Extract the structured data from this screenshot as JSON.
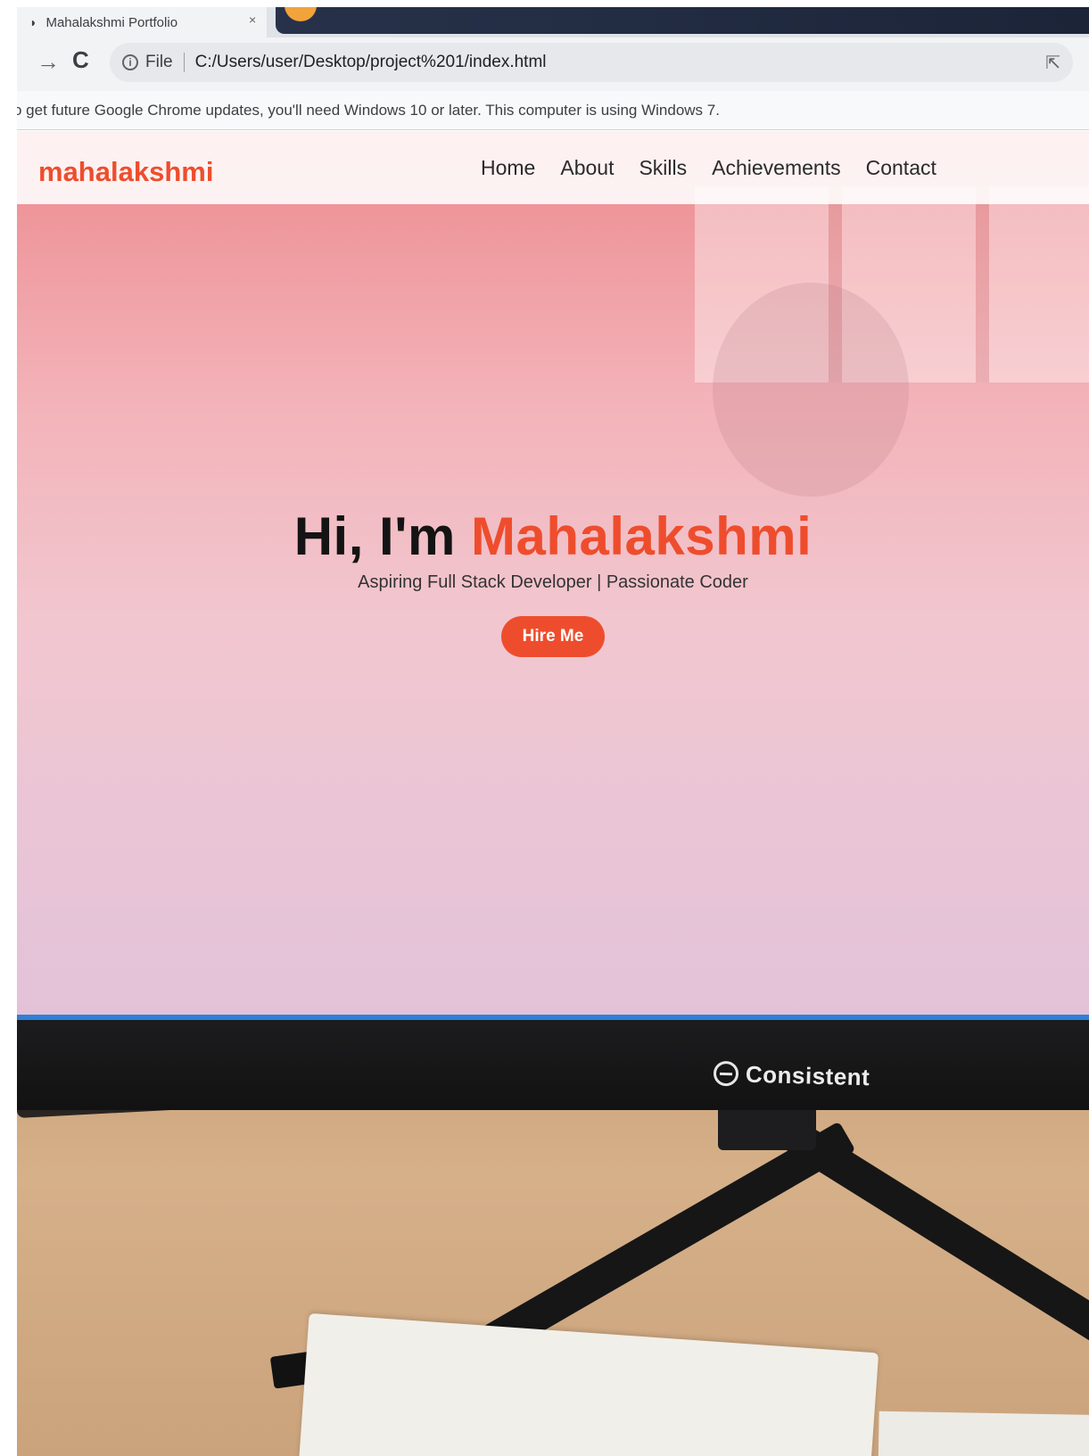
{
  "browser": {
    "tab_title": "Mahalakshmi Portfolio",
    "tab_close_icon": "×",
    "omnibox": {
      "file_label": "File",
      "url": "C:/Users/user/Desktop/project%201/index.html"
    },
    "infobar_text": "o get future Google Chrome updates, you'll need Windows 10 or later. This computer is using Windows 7."
  },
  "site": {
    "brand": "mahalakshmi",
    "nav": [
      "Home",
      "About",
      "Skills",
      "Achievements",
      "Contact"
    ],
    "hero": {
      "greeting": "Hi, I'm ",
      "name": "Mahalakshmi",
      "subtitle": "Aspiring Full Stack Developer | Passionate Coder",
      "button_label": "Hire Me"
    }
  },
  "monitor": {
    "brand": "Consistent"
  },
  "colors": {
    "accent": "#ee4d2d",
    "screen_edge": "#2f7fd8"
  }
}
